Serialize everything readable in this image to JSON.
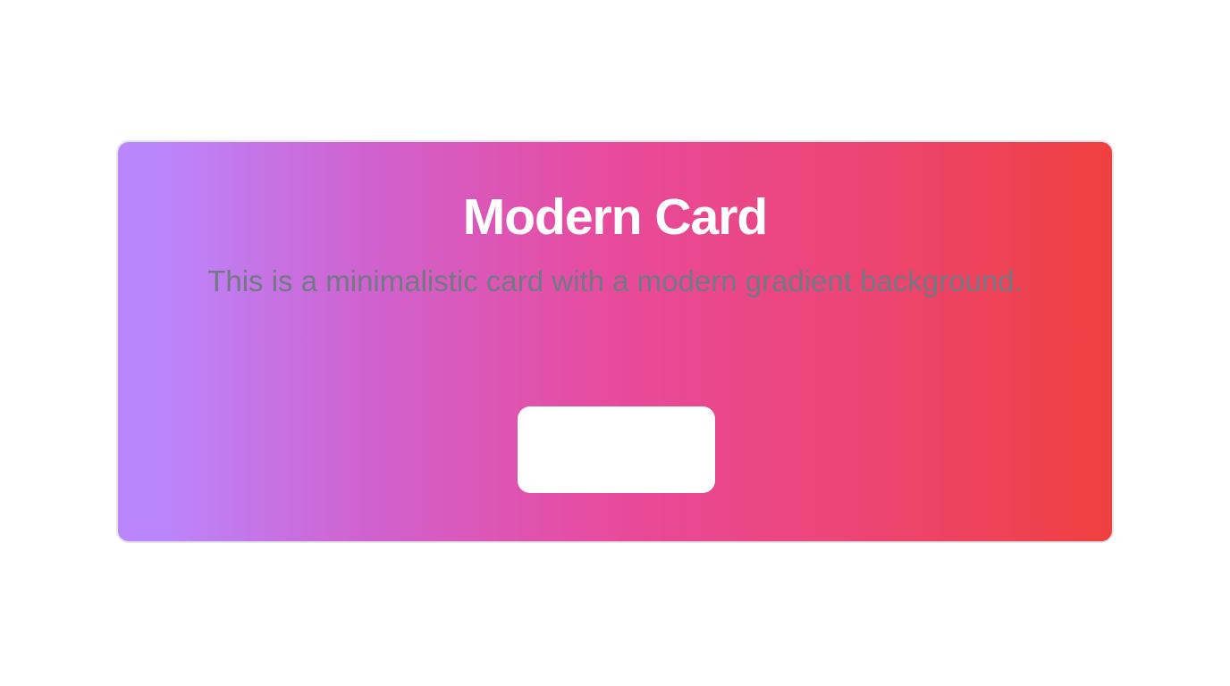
{
  "card": {
    "title": "Modern Card",
    "description": "This is a minimalistic card with a modern gradient background.",
    "button_label": "",
    "gradient_colors": [
      "#bb86fc",
      "#d062cf",
      "#e84a9c",
      "#ec4579",
      "#ef4040"
    ],
    "title_color": "#ffffff",
    "description_color": "#727884",
    "button_color": "#ffffff"
  }
}
